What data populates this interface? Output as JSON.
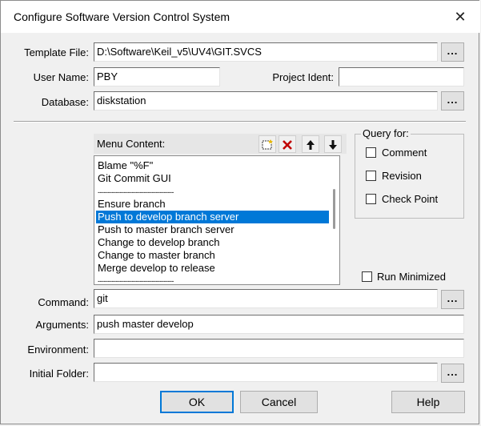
{
  "window": {
    "title": "Configure Software Version Control System",
    "close_glyph": "✕"
  },
  "template_file": {
    "label": "Template File:",
    "value": "D:\\Software\\Keil_v5\\UV4\\GIT.SVCS",
    "browse_label": "..."
  },
  "user_name": {
    "label": "User Name:",
    "value": "PBY"
  },
  "project_ident": {
    "label": "Project Ident:",
    "value": ""
  },
  "database": {
    "label": "Database:",
    "value": "diskstation",
    "browse_label": "..."
  },
  "menu_content": {
    "label": "Menu Content:",
    "tools": [
      "new-item-icon",
      "delete-icon",
      "move-up-icon",
      "move-down-icon"
    ],
    "items": [
      "Blame \"%F\"",
      "Git Commit GUI",
      "--------------------------------------",
      "Ensure branch",
      "Push to develop branch server",
      "Push to master branch server",
      "Change to develop branch",
      "Change to master branch",
      "Merge develop to release",
      "--------------------------------------"
    ],
    "selected_index": 4
  },
  "query_for": {
    "title": "Query for:",
    "options": [
      {
        "label": "Comment",
        "checked": false
      },
      {
        "label": "Revision",
        "checked": false
      },
      {
        "label": "Check Point",
        "checked": false
      }
    ]
  },
  "run_minimized": {
    "label": "Run Minimized",
    "checked": false
  },
  "command": {
    "label": "Command:",
    "value": "git",
    "browse_label": "..."
  },
  "arguments": {
    "label": "Arguments:",
    "value": "push master develop"
  },
  "environment": {
    "label": "Environment:",
    "value": ""
  },
  "initial_folder": {
    "label": "Initial Folder:",
    "value": "",
    "browse_label": "..."
  },
  "buttons": {
    "ok": "OK",
    "cancel": "Cancel",
    "help": "Help"
  },
  "colors": {
    "selection": "#0078d7",
    "default_button_border": "#0078d7"
  }
}
